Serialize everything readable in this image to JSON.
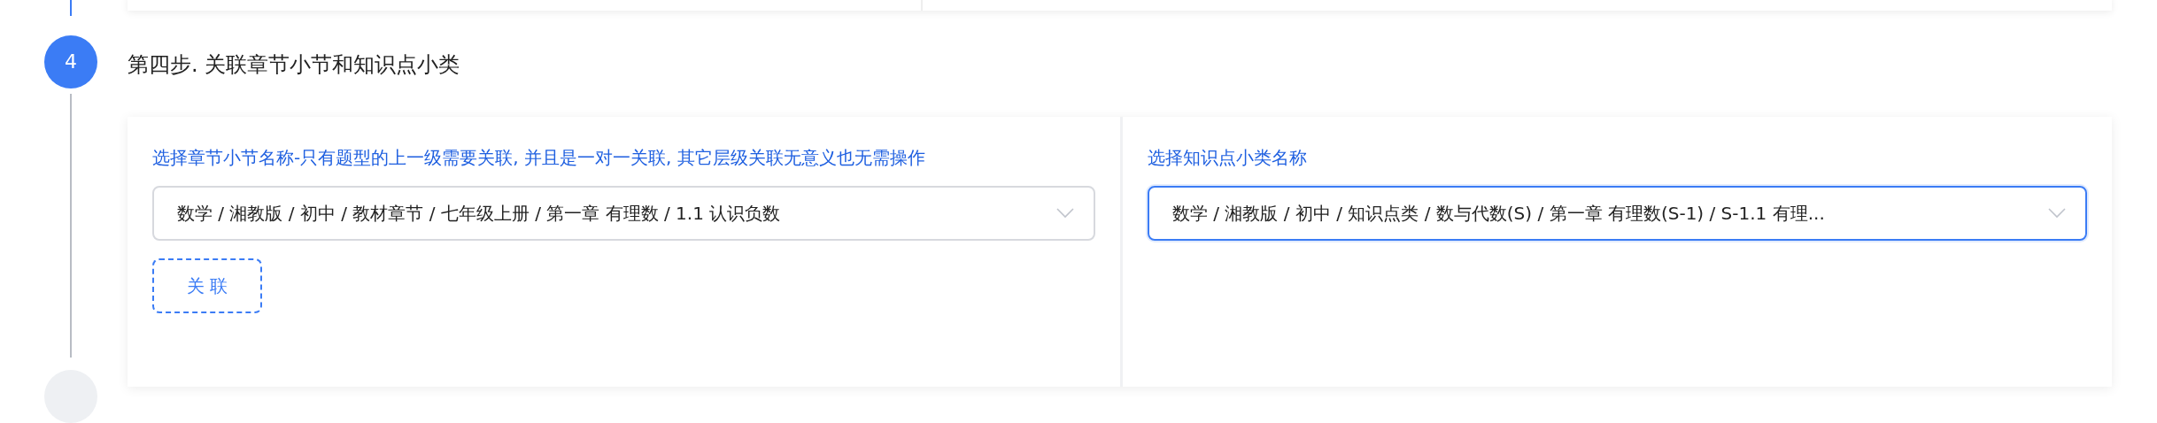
{
  "step": {
    "number": "4",
    "title": "第四步. 关联章节小节和知识点小类"
  },
  "panels": [
    {
      "label": "选择章节小节名称-只有题型的上一级需要关联, 并且是一对一关联, 其它层级关联无意义也无需操作",
      "select": {
        "value": "数学 / 湘教版 / 初中 / 教材章节 / 七年级上册 / 第一章 有理数 / 1.1 认识负数",
        "focused": false
      },
      "button": "关 联"
    },
    {
      "label": "选择知识点小类名称",
      "select": {
        "value": "数学 / 湘教版 / 初中 / 知识点类 / 数与代数(S) / 第一章 有理数(S-1) / S-1.1 有理...",
        "focused": true
      }
    }
  ]
}
